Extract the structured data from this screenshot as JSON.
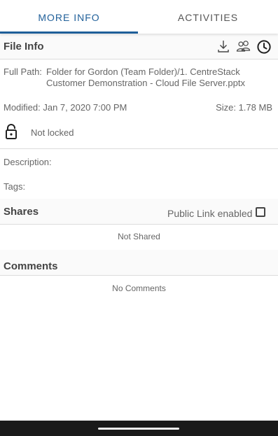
{
  "tabs": {
    "more_info": "MORE INFO",
    "activities": "ACTIVITIES"
  },
  "file_info": {
    "title": "File Info",
    "icons": [
      "download-icon",
      "users-icon",
      "history-clock-icon"
    ],
    "full_path_label": "Full Path:",
    "full_path_line1": "Folder for Gordon (Team Folder)/1. CentreStack",
    "full_path_line2": "Customer Demonstration - Cloud File Server.pptx",
    "modified": "Modified: Jan 7, 2020 7:00 PM",
    "size": "Size: 1.78 MB",
    "lock_status": "Not locked",
    "description_label": "Description:",
    "tags_label": "Tags:"
  },
  "shares": {
    "title": "Shares",
    "public_link_label": "Public Link enabled",
    "public_link_checked": false,
    "empty_text": "Not Shared"
  },
  "comments": {
    "title": "Comments",
    "empty_text": "No Comments"
  },
  "colors": {
    "accent": "#1f5f99",
    "text": "#666666",
    "divider": "#dcdcdc"
  }
}
